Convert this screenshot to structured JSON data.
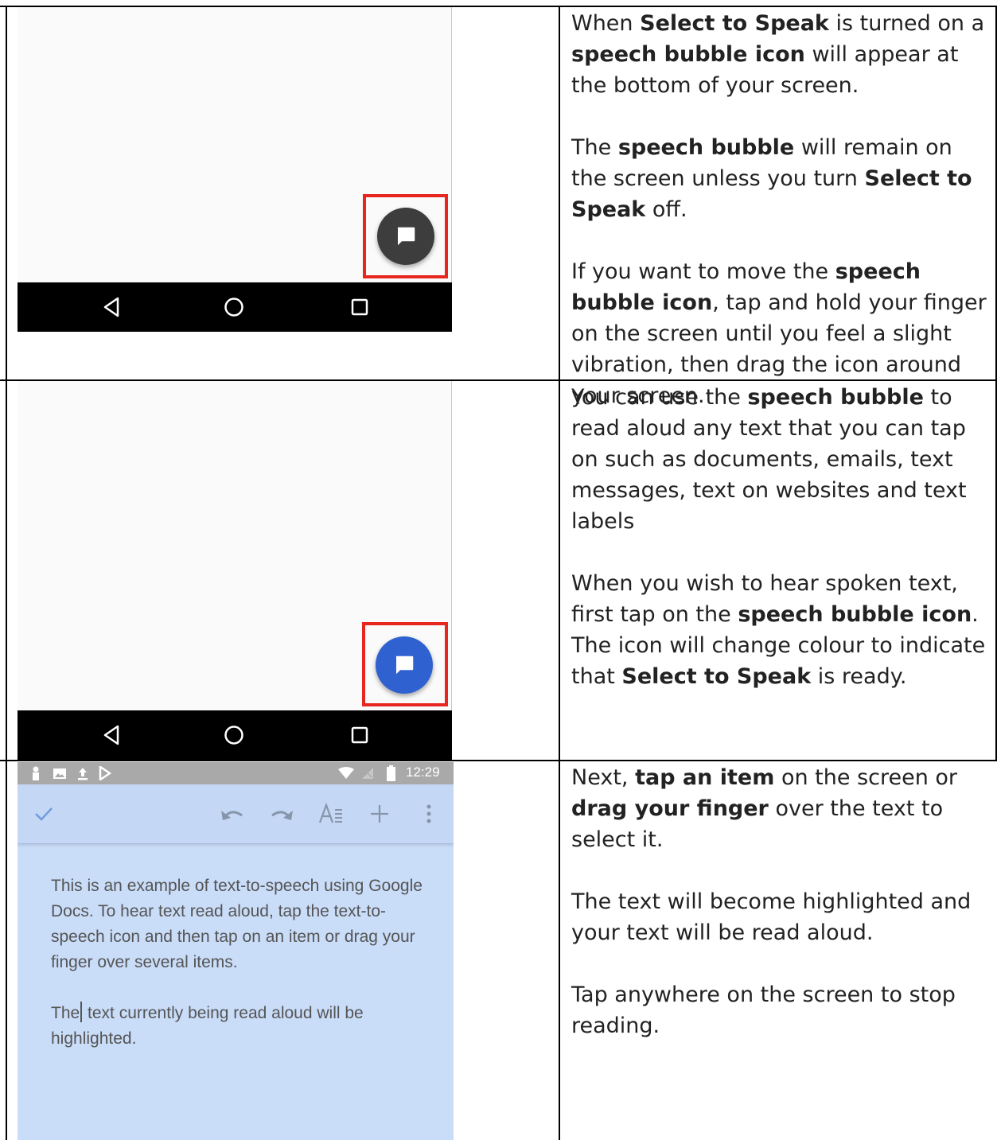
{
  "colors": {
    "highlight_border": "#e6261f",
    "fab_idle": "#3d3d3d",
    "fab_ready": "#2f62d0",
    "docs_highlight": "#c9dcf8"
  },
  "rows": [
    {
      "phone": {
        "state": "idle",
        "nav_icons": [
          "back-icon",
          "home-icon",
          "recents-icon"
        ]
      },
      "paragraphs": [
        [
          {
            "t": "When "
          },
          {
            "t": "Select to Speak",
            "b": true
          },
          {
            "t": " is turned on a "
          },
          {
            "t": "speech bubble icon",
            "b": true
          },
          {
            "t": " will appear at the bottom of your screen."
          }
        ],
        [
          {
            "t": "The "
          },
          {
            "t": "speech bubble",
            "b": true
          },
          {
            "t": " will remain on the screen unless you turn "
          },
          {
            "t": "Select to Speak",
            "b": true
          },
          {
            "t": " off."
          }
        ],
        [
          {
            "t": "If you want to move the "
          },
          {
            "t": "speech bubble icon",
            "b": true
          },
          {
            "t": ", tap and hold your finger on the screen until you feel a slight vibration, then drag the icon around your screen."
          }
        ]
      ]
    },
    {
      "phone": {
        "state": "ready",
        "nav_icons": [
          "back-icon",
          "home-icon",
          "recents-icon"
        ]
      },
      "paragraphs": [
        [
          {
            "t": "You can use the "
          },
          {
            "t": "speech bubble",
            "b": true
          },
          {
            "t": " to read aloud any text that you can tap on such as documents, emails, text messages, text on websites and text labels"
          }
        ],
        [
          {
            "t": "When you wish to hear spoken text, first tap on the "
          },
          {
            "t": "speech bubble icon",
            "b": true
          },
          {
            "t": ". The icon will change colour to indicate that "
          },
          {
            "t": "Select to Speak",
            "b": true
          },
          {
            "t": " is ready."
          }
        ]
      ]
    },
    {
      "docs": {
        "status_time": "12:29",
        "body": [
          "This is an example of text-to-speech using Google Docs. To hear text read aloud, tap the text-to-speech icon and then tap on an item or drag your finger over several items.",
          {
            "before_caret": "The",
            "after_caret": " text currently being read aloud will be highlighted."
          }
        ]
      },
      "paragraphs": [
        [
          {
            "t": "Next, "
          },
          {
            "t": "tap an item",
            "b": true
          },
          {
            "t": " on the screen or "
          },
          {
            "t": "drag your finger",
            "b": true
          },
          {
            "t": " over the text to select it."
          }
        ],
        [
          {
            "t": "The text will become highlighted and your text will be read aloud."
          }
        ],
        [
          {
            "t": "Tap anywhere on the screen to stop reading."
          }
        ]
      ]
    }
  ]
}
